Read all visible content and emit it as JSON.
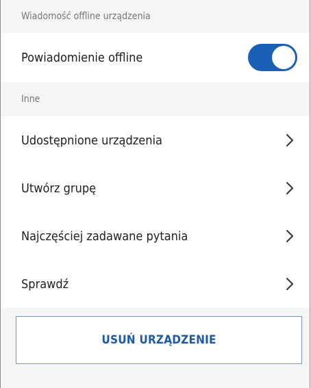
{
  "offline_section": {
    "header": "Wiadomość offline urządzenia",
    "toggle_label": "Powiadomienie offline",
    "toggle_state": "on",
    "toggle_color": "#195fb5"
  },
  "other_section": {
    "header": "Inne",
    "items": [
      {
        "label": "Udostępnione urządzenia",
        "icon": "chevron-right-icon"
      },
      {
        "label": "Utwórz grupę",
        "icon": "chevron-right-icon"
      },
      {
        "label": "Najczęściej zadawane pytania",
        "icon": "chevron-right-icon"
      },
      {
        "label": "Sprawdź",
        "icon": "chevron-right-icon"
      }
    ]
  },
  "actions": {
    "delete_label": "USUŃ URZĄDZENIE",
    "delete_color": "#1c5aa8"
  }
}
